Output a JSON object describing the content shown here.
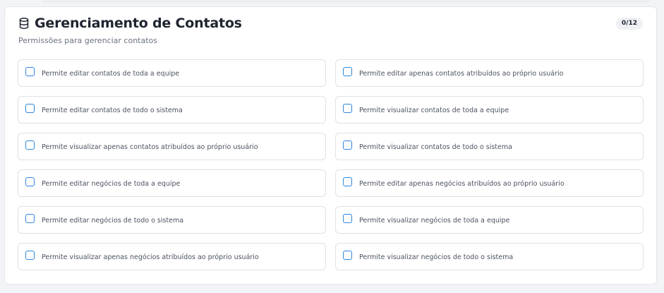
{
  "section": {
    "title": "Gerenciamento de Contatos",
    "subtitle": "Permissões para gerenciar contatos",
    "icon": "database-icon",
    "counter": "0/12"
  },
  "permissions": [
    {
      "label": "Permite editar contatos de toda a equipe",
      "checked": false
    },
    {
      "label": "Permite editar apenas contatos atribuídos ao próprio usuário",
      "checked": false
    },
    {
      "label": "Permite editar contatos de todo o sistema",
      "checked": false
    },
    {
      "label": "Permite visualizar contatos de toda a equipe",
      "checked": false
    },
    {
      "label": "Permite visualizar apenas contatos atribuídos ao próprio usuário",
      "checked": false
    },
    {
      "label": "Permite visualizar contatos de todo o sistema",
      "checked": false
    },
    {
      "label": "Permite editar negócios de toda a equipe",
      "checked": false
    },
    {
      "label": "Permite editar apenas negócios atribuídos ao próprio usuário",
      "checked": false
    },
    {
      "label": "Permite editar negócios de todo o sistema",
      "checked": false
    },
    {
      "label": "Permite visualizar negócios de toda a equipe",
      "checked": false
    },
    {
      "label": "Permite visualizar apenas negócios atribuídos ao próprio usuário",
      "checked": false
    },
    {
      "label": "Permite visualizar negócios de todo o sistema",
      "checked": false
    }
  ],
  "colors": {
    "checkbox_border": "#2e86de",
    "title_text": "#1f2430",
    "muted_text": "#6b7280"
  }
}
